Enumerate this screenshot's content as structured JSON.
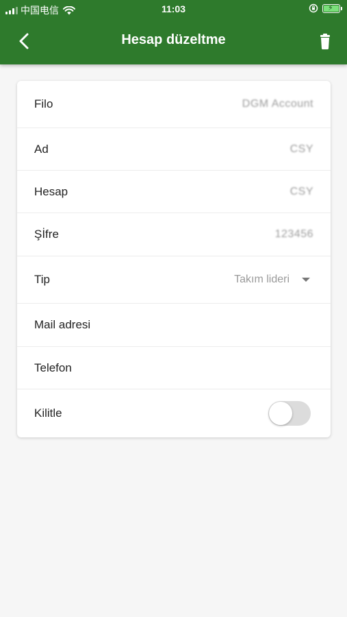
{
  "status_bar": {
    "carrier": "中国电信",
    "time": "11:03"
  },
  "nav": {
    "title": "Hesap düzeltme",
    "back_icon": "chevron-left-icon",
    "delete_icon": "trash-icon"
  },
  "colors": {
    "header_bg": "#2e7a2c",
    "page_bg": "#f6f6f6"
  },
  "form": {
    "fields": [
      {
        "label": "Filo",
        "value": "DGM Account"
      },
      {
        "label": "Ad",
        "value": "CSY"
      },
      {
        "label": "Hesap",
        "value": "CSY"
      },
      {
        "label": "Şİfre",
        "value": "123456"
      },
      {
        "label": "Tip",
        "value": "Takım lideri"
      },
      {
        "label": "Mail adresi",
        "value": ""
      },
      {
        "label": "Telefon",
        "value": ""
      },
      {
        "label": "Kilitle",
        "toggle_on": false
      }
    ]
  }
}
